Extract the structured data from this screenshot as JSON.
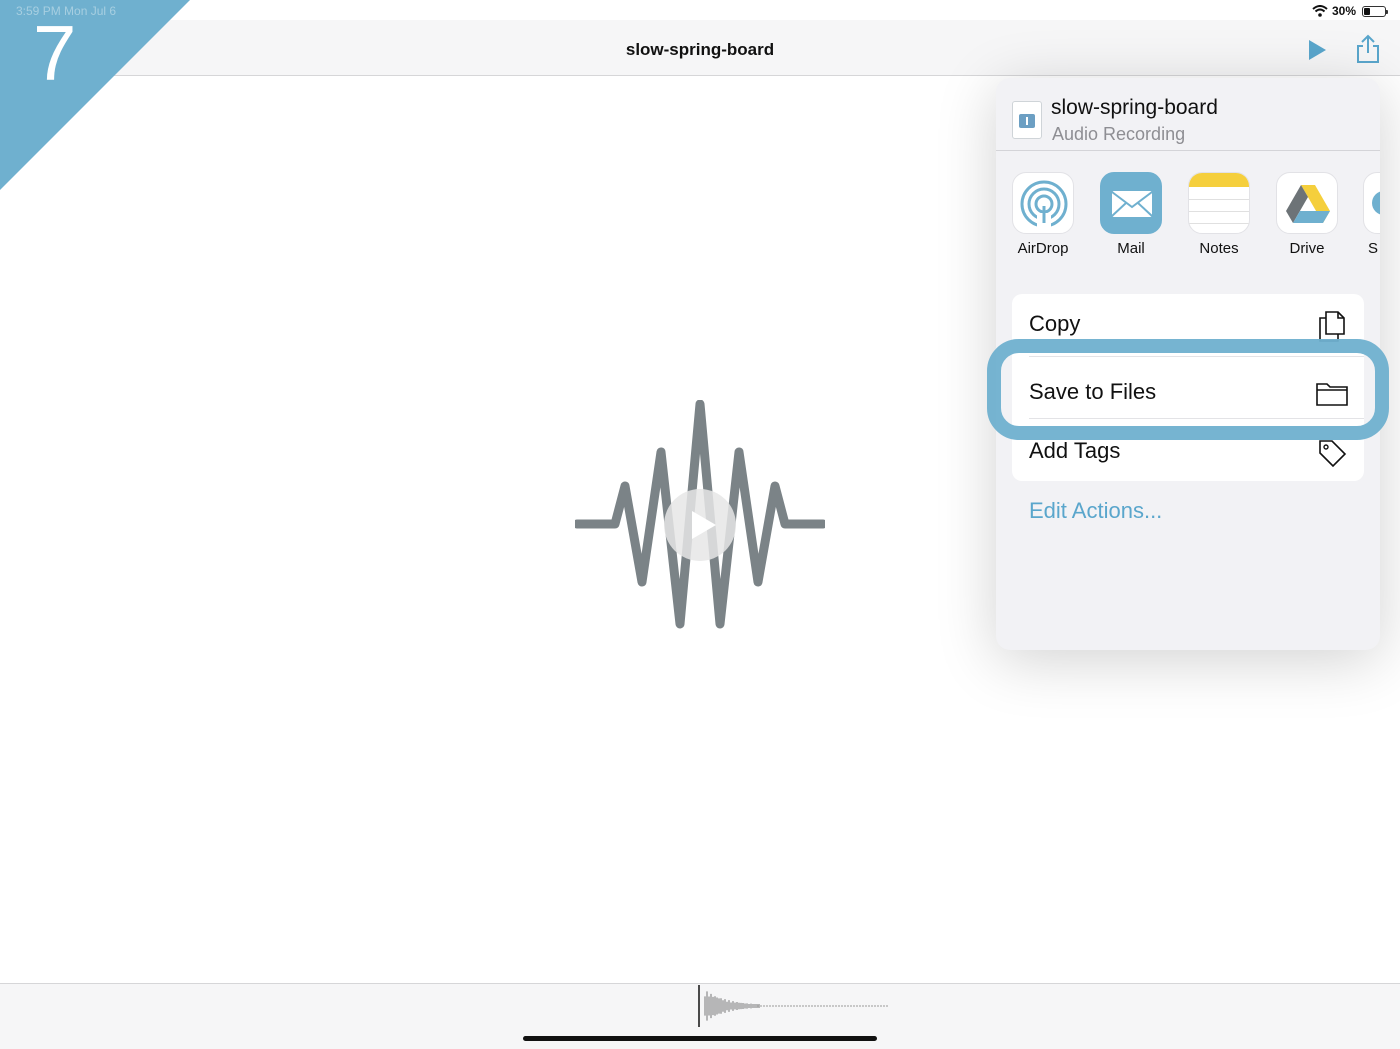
{
  "status_bar": {
    "time": "3:59 PM  Mon Jul 6",
    "battery_percent": "30%",
    "battery_level": 0.3
  },
  "step": {
    "number": "7"
  },
  "navbar": {
    "title": "slow-spring-board",
    "play_icon": "play-icon",
    "share_icon": "share-icon"
  },
  "player": {
    "icon": "waveform-icon",
    "play_icon": "play-icon"
  },
  "share_sheet": {
    "file_name": "slow-spring-board",
    "file_type": "Audio Recording",
    "apps": [
      {
        "label": "AirDrop",
        "icon": "airdrop-icon"
      },
      {
        "label": "Mail",
        "icon": "mail-icon"
      },
      {
        "label": "Notes",
        "icon": "notes-icon"
      },
      {
        "label": "Drive",
        "icon": "drive-icon"
      },
      {
        "label": "S",
        "icon": "app-icon"
      }
    ],
    "actions": [
      {
        "label": "Copy",
        "icon": "copy-icon"
      },
      {
        "label": "Save to Files",
        "icon": "folder-icon",
        "highlighted": true
      },
      {
        "label": "Add Tags",
        "icon": "tag-icon"
      }
    ],
    "edit_actions": "Edit Actions...",
    "accent_color": "#5aa6cc",
    "highlight_color": "#6fb0cf"
  }
}
